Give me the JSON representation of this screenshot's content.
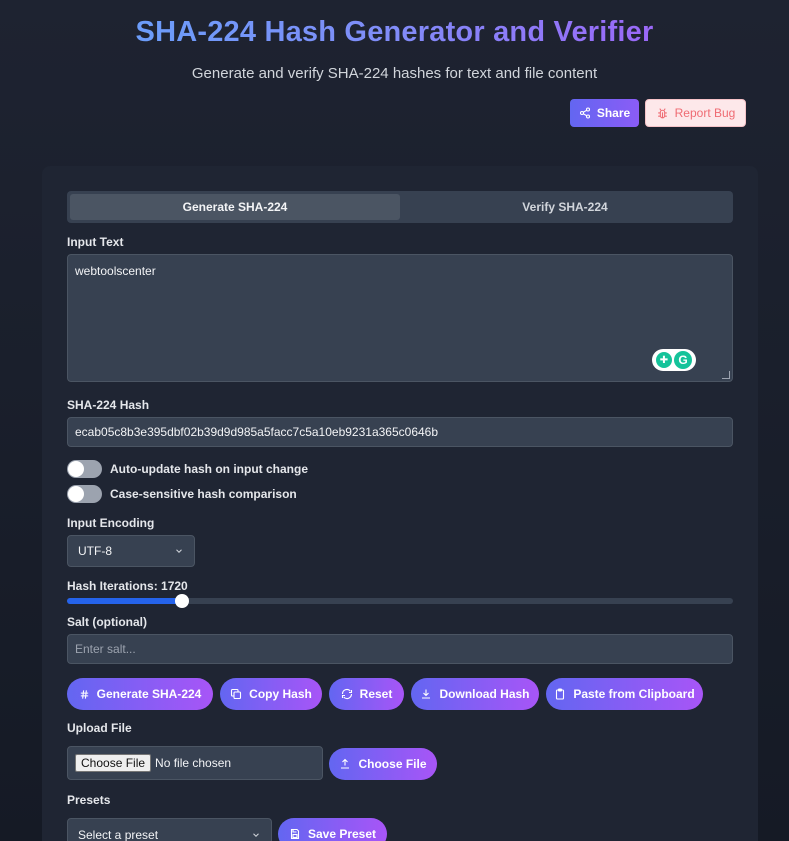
{
  "header": {
    "title": "SHA-224 Hash Generator and Verifier",
    "subtitle": "Generate and verify SHA-224 hashes for text and file content",
    "share_label": "Share",
    "report_bug_label": "Report Bug"
  },
  "tabs": [
    {
      "label": "Generate SHA-224",
      "active": true
    },
    {
      "label": "Verify SHA-224",
      "active": false
    }
  ],
  "input_text": {
    "label": "Input Text",
    "value": "webtoolscenter"
  },
  "hash_output": {
    "label": "SHA-224 Hash",
    "value": "ecab05c8b3e395dbf02b39d9d985a5facc7c5a10eb9231a365c0646b"
  },
  "toggles": [
    {
      "label": "Auto-update hash on input change",
      "on": false
    },
    {
      "label": "Case-sensitive hash comparison",
      "on": false
    }
  ],
  "encoding": {
    "label": "Input Encoding",
    "selected": "UTF-8"
  },
  "iterations": {
    "label": "Hash Iterations: 1720",
    "value": 1720,
    "fill_fraction": 0.172
  },
  "salt": {
    "label": "Salt (optional)",
    "placeholder": "Enter salt..."
  },
  "actions": [
    {
      "label": "Generate SHA-224",
      "icon": "hash-icon"
    },
    {
      "label": "Copy Hash",
      "icon": "copy-icon"
    },
    {
      "label": "Reset",
      "icon": "refresh-icon"
    },
    {
      "label": "Download Hash",
      "icon": "download-icon"
    },
    {
      "label": "Paste from Clipboard",
      "icon": "clipboard-icon"
    }
  ],
  "upload": {
    "label": "Upload File",
    "native_button": "Choose File",
    "status": "No file chosen",
    "button_label": "Choose File"
  },
  "presets": {
    "label": "Presets",
    "selected": "Select a preset",
    "save_label": "Save Preset"
  },
  "colors": {
    "accent_gradient_start": "#6366f1",
    "accent_gradient_end": "#a855f7",
    "slider_fill": "#2563eb",
    "background": "#1a1f2b",
    "card": "#1f2533"
  }
}
